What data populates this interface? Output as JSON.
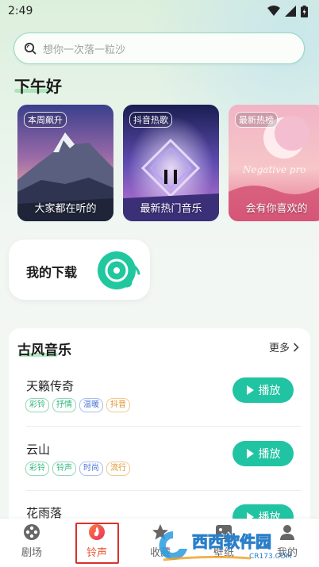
{
  "status_bar": {
    "time": "2:49"
  },
  "search": {
    "placeholder": "想你一次落一粒沙"
  },
  "greeting": "下午好",
  "cards": [
    {
      "tag": "本周飙升",
      "title": "大家都在听的"
    },
    {
      "tag": "抖音热歌",
      "title": "最新热门音乐"
    },
    {
      "tag": "最新热榜",
      "title": "会有你喜欢的",
      "overlay_text": "Negative pro"
    }
  ],
  "download": {
    "label": "我的下载"
  },
  "section": {
    "title": "古风音乐",
    "more_label": "更多",
    "songs": [
      {
        "name": "天籁传奇",
        "tags": [
          "彩铃",
          "抒情",
          "温暖",
          "抖音"
        ],
        "play_label": "播放"
      },
      {
        "name": "云山",
        "tags": [
          "彩铃",
          "铃声",
          "时尚",
          "流行"
        ],
        "play_label": "播放"
      },
      {
        "name": "花雨落",
        "tags": [],
        "play_label": "播放"
      }
    ]
  },
  "bottom_nav": {
    "items": [
      {
        "label": "剧场",
        "icon": "film-reel-icon"
      },
      {
        "label": "铃声",
        "icon": "flame-note-icon",
        "active": true
      },
      {
        "label": "收藏",
        "icon": "star-icon"
      },
      {
        "label": "壁纸",
        "icon": "image-icon"
      },
      {
        "label": "我的",
        "icon": "user-icon"
      }
    ]
  },
  "watermark": {
    "text": "西西软件园",
    "subtext": "CR173.COM"
  },
  "colors": {
    "accent": "#21c4a2",
    "active_nav": "#e85a3a",
    "search_border": "#8fd8c2"
  }
}
